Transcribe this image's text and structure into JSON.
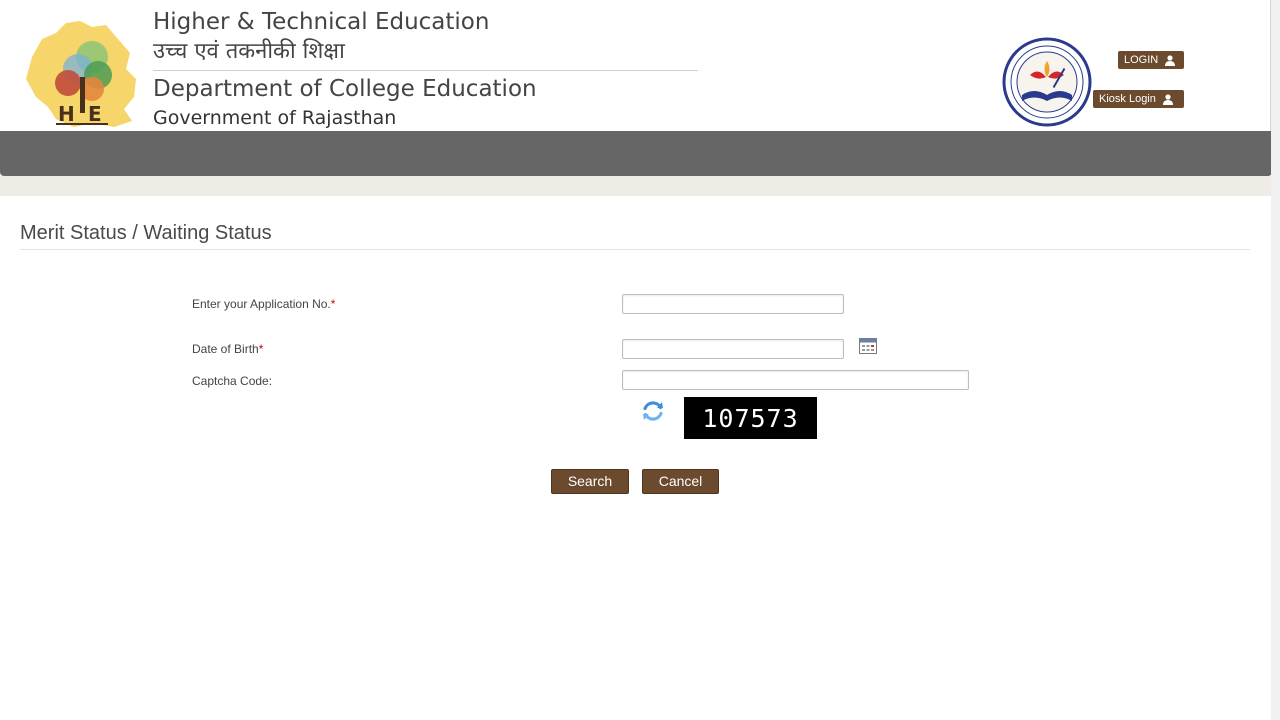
{
  "header": {
    "title_en": "Higher & Technical Education",
    "title_hi": "उच्च एवं तकनीकी शिक्षा",
    "department": "Department of College Education",
    "government": "Government of Rajasthan",
    "login_label": "LOGIN",
    "kiosk_label": "Kiosk Login",
    "logo_icon": "hte-rajasthan-logo-icon",
    "seal_icon": "college-education-seal-icon",
    "accent": "#6b4a2e",
    "nav_color": "#666666"
  },
  "page": {
    "title": "Merit Status / Waiting Status"
  },
  "form": {
    "app_no_label": "Enter your Application No.",
    "dob_label": "Date of Birth",
    "captcha_label": "Captcha Code:",
    "required_mark": "*",
    "app_no_value": "",
    "dob_value": "",
    "captcha_value": "",
    "captcha_code": "107573",
    "search_label": "Search",
    "cancel_label": "Cancel"
  }
}
